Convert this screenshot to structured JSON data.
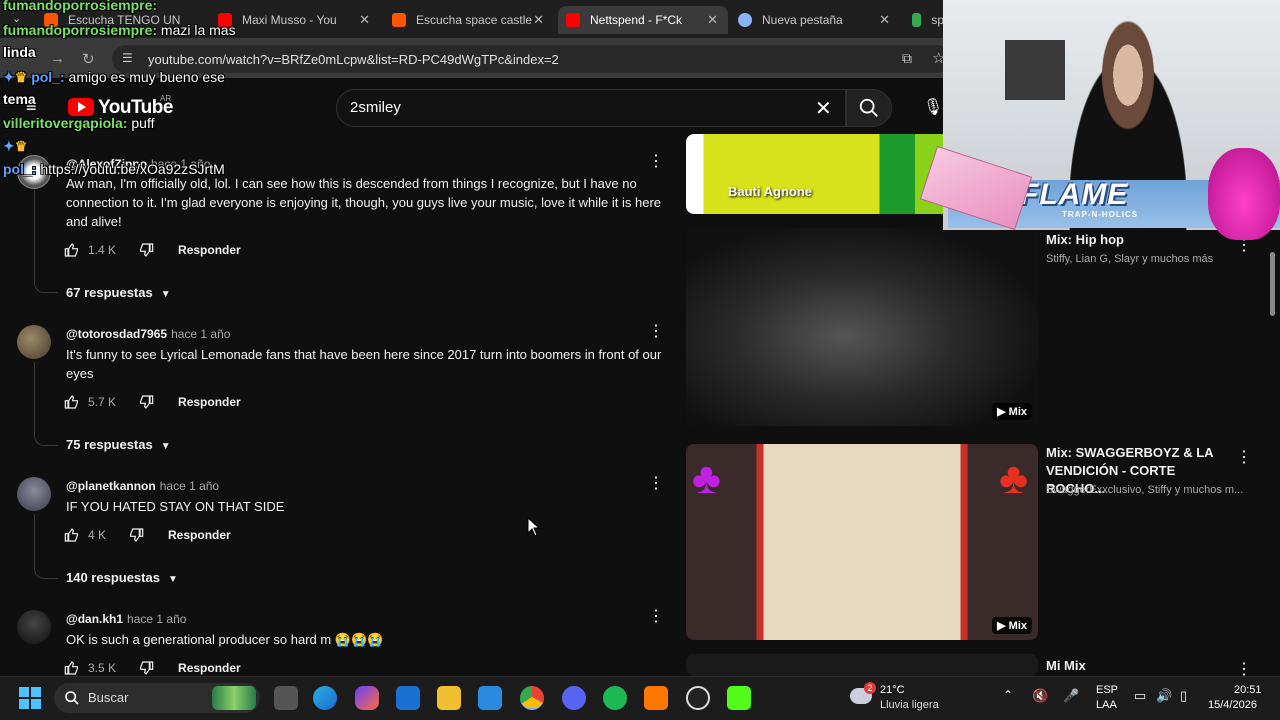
{
  "browser": {
    "tabs": [
      {
        "label": "Escucha TENGO UN",
        "color": "#ff5500"
      },
      {
        "label": "Maxi Musso - You",
        "color": "#ff0000"
      },
      {
        "label": "Escucha space castle",
        "color": "#ff5500"
      },
      {
        "label": "Nettspend - F*Ck",
        "color": "#ff0000"
      },
      {
        "label": "Nueva pestaña",
        "color": "#8ab4f8"
      },
      {
        "label": "sp",
        "color": "#34a853"
      }
    ],
    "url": "youtube.com/watch?v=BRfZe0mLcpw&list=RD-PC49dWgTPc&index=2"
  },
  "youtube": {
    "logo_text": "YouTube",
    "region": "AR",
    "search_query": "2smiley"
  },
  "comments": [
    {
      "author": "@AlexofZippo",
      "ago": "hace 1 año",
      "text": "Aw man, I'm officially old, lol. I can see how this is descended from things I recognize, but I have no connection to it. I'm glad everyone is enjoying it, though, you guys live your music, love it while it is here and alive!",
      "likes": "1.4 K",
      "reply_label": "Responder",
      "replies": "67 respuestas"
    },
    {
      "author": "@totorosdad7965",
      "ago": "hace 1 año",
      "text": "It's funny to see Lyrical Lemonade fans that have been here since 2017 turn into boomers in front of our eyes",
      "likes": "5.7 K",
      "reply_label": "Responder",
      "replies": "75 respuestas"
    },
    {
      "author": "@planetkannon",
      "ago": "hace 1 año",
      "text": "IF YOU HATED STAY ON THAT SIDE",
      "likes": "4 K",
      "reply_label": "Responder",
      "replies": "140 respuestas"
    },
    {
      "author": "@dan.kh1",
      "ago": "hace 1 año",
      "text": "OK is such a generational producer so hard m 😭😭😭",
      "likes": "3.5 K",
      "reply_label": "Responder"
    }
  ],
  "sidebar": {
    "videos": [
      {
        "title": "",
        "meta": "",
        "thumb_label": "Bauti Agnone"
      },
      {
        "title": "Mix: Hip hop",
        "meta": "Stiffy, Lian G, Slayr y muchos más",
        "badge": "Mix"
      },
      {
        "title": "Mix: SWAGGERBOYZ & LA VENDICIÓN - CORTE ROCHO...",
        "meta": "SwaggerExxclusivo, Stiffy y muchos m...",
        "badge": "Mix"
      },
      {
        "title": "Mi Mix",
        "meta": ""
      }
    ]
  },
  "chat": [
    {
      "user": "fumandoporrosiempre:",
      "msg": ""
    },
    {
      "user": "fumandoporrosiempre:",
      "msg": "mazi la mas"
    },
    {
      "user": "",
      "msg": "linda"
    },
    {
      "user": "pol_:",
      "msg": "amigo es muy bueno ese"
    },
    {
      "user": "",
      "msg": "tema"
    },
    {
      "user": "villeritovergapiola:",
      "msg": "puff"
    },
    {
      "user": "pol_:",
      "msg": "https://youtu.be/xOa92zSJrtM"
    }
  ],
  "overlay": {
    "banner_text": "FLAME",
    "banner_sub": "TRAP-N-HOLICS"
  },
  "taskbar": {
    "search_placeholder": "Buscar",
    "weather_temp": "21°C",
    "weather_desc": "Lluvia ligera",
    "weather_badge": "2",
    "lang_1": "ESP",
    "lang_2": "LAA",
    "time": "20:51",
    "date": "15/4/2026"
  },
  "colors": {
    "bg": "#0f0f0f",
    "yt_red": "#ff0000",
    "text_secondary": "#aaaaaa"
  }
}
